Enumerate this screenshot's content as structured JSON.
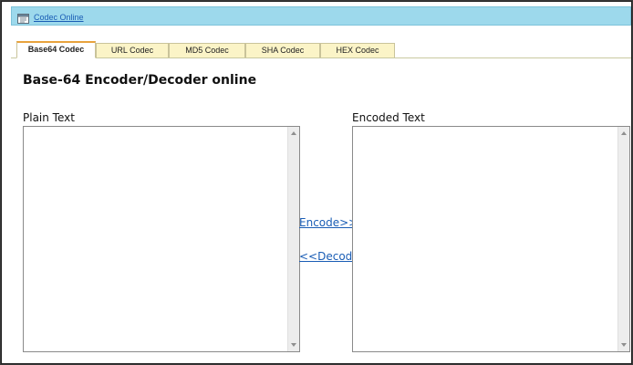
{
  "header": {
    "site_link": "Codec Online",
    "icon": "window-icon",
    "bar_color": "#9dd9ec"
  },
  "tabs": [
    {
      "label": "Base64 Codec",
      "active": true
    },
    {
      "label": "URL Codec",
      "active": false
    },
    {
      "label": "MD5 Codec",
      "active": false
    },
    {
      "label": "SHA Codec",
      "active": false
    },
    {
      "label": "HEX Codec",
      "active": false
    }
  ],
  "main": {
    "title": "Base-64 Encoder/Decoder online",
    "plain": {
      "label": "Plain Text",
      "value": ""
    },
    "encoded": {
      "label": "Encoded Text",
      "value": ""
    },
    "encode_label": "Encode>>",
    "decode_label": "<<Decode",
    "link_color": "#1a5db5"
  }
}
